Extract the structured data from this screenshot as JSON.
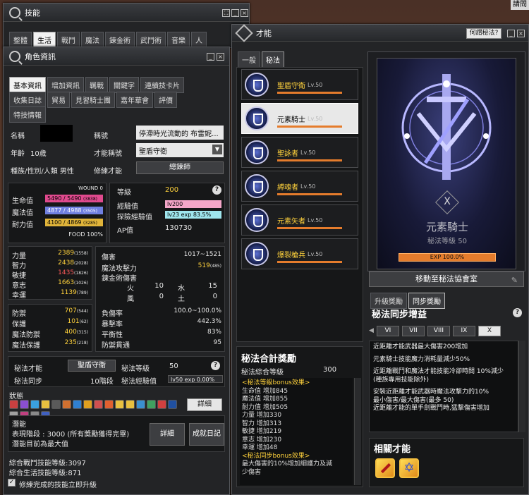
{
  "top_right_label": "請問",
  "skills_window": {
    "title": "技能",
    "tabs": [
      "整體",
      "生活",
      "戰鬥",
      "魔法",
      "鍊金術",
      "武鬥術",
      "音樂",
      "人"
    ]
  },
  "char_window": {
    "title": "角色資訊",
    "tabs_row1": [
      "基本資訊",
      "增加資訊",
      "羈戰",
      "關鍵字",
      "連續技卡片"
    ],
    "tabs_row2": [
      "收集日誌",
      "貿易",
      "見習騎士團",
      "嘉年華會",
      "評價"
    ],
    "tabs_row3": [
      "特技情報"
    ],
    "name_label": "名稱",
    "age_label": "年齡",
    "age_value": "10歲",
    "race_label": "種族/性別/人類 男性",
    "title_label": "稱號",
    "title_value": "停滯時光流動的 布雷妮...",
    "talent_title_label": "才能稱號",
    "talent_title_value": "聖盾守衛",
    "train_label": "修練才能",
    "train_value": "總鍊師",
    "wound": "WOUND 0",
    "hp_label": "生命值",
    "hp_value": "5490 / 5490",
    "hp_extra": "(3838)",
    "mp_label": "魔法值",
    "mp_value": "4877 / 4988",
    "mp_extra": "(3505)",
    "sp_label": "耐力值",
    "sp_value": "4100 / 4869",
    "sp_extra": "(3285)",
    "food": "FOOD 100%",
    "level_label": "等級",
    "level_value": "200",
    "exp_label": "經驗值",
    "exp_value": "lv200",
    "explore_label": "探險經驗值",
    "explore_value": "lv23 exp 83.5%",
    "ap_label": "AP值",
    "ap_value": "130730",
    "stats": [
      {
        "label": "力量",
        "value": "2389",
        "extra": "(1558)"
      },
      {
        "label": "智力",
        "value": "2438",
        "extra": "(2028)"
      },
      {
        "label": "敏捷",
        "value": "1435",
        "extra": "(1826)"
      },
      {
        "label": "意志",
        "value": "1663",
        "extra": "(1026)"
      },
      {
        "label": "幸運",
        "value": "1139",
        "extra": "(789)"
      }
    ],
    "dmg_label": "傷害",
    "dmg_value": "1017~1521",
    "matk_label": "魔法攻擊力",
    "matk_value": "519",
    "matk_extra": "(485)",
    "alch_label": "鍊金術傷害",
    "elem": [
      {
        "a": "火",
        "av": "10",
        "b": "水",
        "bv": "15"
      },
      {
        "a": "風",
        "av": "0",
        "b": "土",
        "bv": "0"
      }
    ],
    "neg_label": "負傷率",
    "neg_value": "100.0~100.0%",
    "crit_label": "暴擊率",
    "crit_value": "442.3%",
    "bal_label": "平衡性",
    "bal_value": "83%",
    "pierce_label": "防禦貫通",
    "pierce_value": "95",
    "defs": [
      {
        "label": "防禦",
        "value": "707",
        "extra": "(544)"
      },
      {
        "label": "保護",
        "value": "101",
        "extra": "(62)"
      },
      {
        "label": "魔法防禦",
        "value": "400",
        "extra": "(315)"
      },
      {
        "label": "魔法保護",
        "value": "235",
        "extra": "(218)"
      }
    ],
    "arcane_label": "秘法才能",
    "arcane_value": "聖盾守衛",
    "arcane_level_label": "秘法等級",
    "arcane_level_value": "50",
    "arcane_sync_label": "秘法同步",
    "arcane_sync_value": "10階段",
    "arcane_exp_label": "秘法經驗值",
    "arcane_exp_value": "lv50 exp 0.00%",
    "status_label": "狀態",
    "detail_btn": "詳細",
    "potential_label": "潛能",
    "potential_line1": "表現階段 : 3000 (所有獎勵獲得完畢)",
    "potential_line2": "潛能目前為最大值",
    "potential_detail": "詳細",
    "achievement_btn": "成就日記",
    "battle_total": "綜合戰鬥技能等級:3097",
    "life_total": "綜合生活技能等級:871",
    "checkbox_label": "修練完成的技能立即升級"
  },
  "talent_window": {
    "title": "才能",
    "help_btn": "何謂秘法?",
    "tabs": [
      "一般",
      "秘法"
    ],
    "talents": [
      {
        "name": "聖盾守衛",
        "lv": "Lv.50"
      },
      {
        "name": "元素騎士",
        "lv": "Lv.50"
      },
      {
        "name": "聖詠者",
        "lv": "Lv.50"
      },
      {
        "name": "縛魂者",
        "lv": "Lv.50"
      },
      {
        "name": "元素矢者",
        "lv": "Lv.50"
      },
      {
        "name": "爆裂槍兵",
        "lv": "Lv.50"
      }
    ],
    "reward_title": "秘法合計獎勵",
    "reward_level_label": "秘法綜合等級",
    "reward_level_value": "300",
    "reward_lines": [
      "<秘法等級bonus效果>",
      "生命值 增加845",
      "魔法值 增加855",
      "耐力值 增加505",
      "力量 增加330",
      "智力 增加313",
      "敏捷 增加219",
      "意志 增加230",
      "幸運 增加48",
      "<秘法同步bonus效果>",
      "最大傷害的10%增加細護力及減",
      "少傷害"
    ],
    "card_name": "元素騎士",
    "card_level": "秘法等級 50",
    "card_exp": "EXP 100.0%",
    "card_mark": "X",
    "move_btn": "移動至秘法協會室",
    "sub_tabs": [
      "升級獎勵",
      "同步獎勵"
    ],
    "sync_title": "秘法同步增益",
    "roman": [
      "VI",
      "VII",
      "VIII",
      "IX",
      "X"
    ],
    "sync_lines": [
      "近距離才能武器最大傷害200增加",
      "",
      "元素騎士技能魔力消耗量減少50%",
      "",
      "近距離戰鬥和魔法才能技能冷卻時間 10%減少",
      "(種族專用技能除外)",
      "",
      "安裝近距離才能武器時魔法攻擊力的10%",
      "最小傷害/最大傷害(最多 50)",
      "近距離才能的單手劍戰鬥時,猛擊傷害增加"
    ],
    "related_title": "相關才能"
  }
}
